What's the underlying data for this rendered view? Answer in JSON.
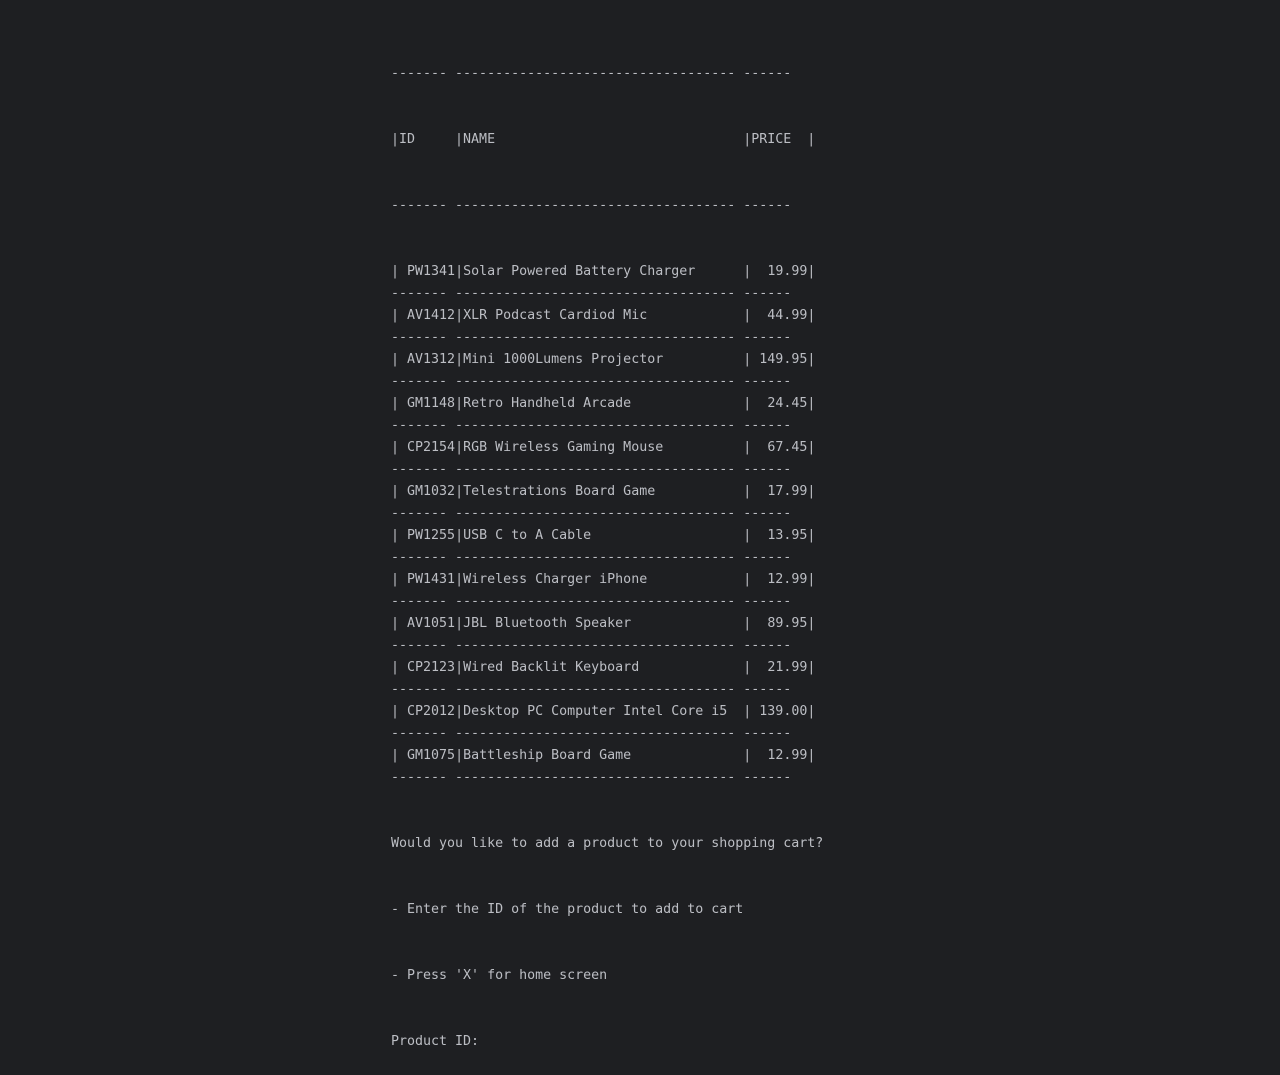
{
  "table": {
    "separator": "------- ----------------------------------- ------",
    "header": "|ID     |NAME                               |PRICE  |",
    "rows": [
      {
        "id": "PW1341",
        "name": "Solar Powered Battery Charger",
        "price": "19.99"
      },
      {
        "id": "AV1412",
        "name": "XLR Podcast Cardiod Mic",
        "price": "44.99"
      },
      {
        "id": "AV1312",
        "name": "Mini 1000Lumens Projector",
        "price": "149.95"
      },
      {
        "id": "GM1148",
        "name": "Retro Handheld Arcade",
        "price": "24.45"
      },
      {
        "id": "CP2154",
        "name": "RGB Wireless Gaming Mouse",
        "price": "67.45"
      },
      {
        "id": "GM1032",
        "name": "Telestrations Board Game",
        "price": "17.99"
      },
      {
        "id": "PW1255",
        "name": "USB C to A Cable",
        "price": "13.95"
      },
      {
        "id": "PW1431",
        "name": "Wireless Charger iPhone",
        "price": "12.99"
      },
      {
        "id": "AV1051",
        "name": "JBL Bluetooth Speaker",
        "price": "89.95"
      },
      {
        "id": "CP2123",
        "name": "Wired Backlit Keyboard",
        "price": "21.99"
      },
      {
        "id": "CP2012",
        "name": "Desktop PC Computer Intel Core i5",
        "price": "139.00"
      },
      {
        "id": "GM1075",
        "name": "Battleship Board Game",
        "price": "12.99"
      }
    ]
  },
  "prompt": {
    "question": "Would you like to add a product to your shopping cart?",
    "option_add": "- Enter the ID of the product to add to cart",
    "option_home": "- Press 'X' for home screen",
    "input_label": "Product ID: ",
    "input_value": ""
  }
}
